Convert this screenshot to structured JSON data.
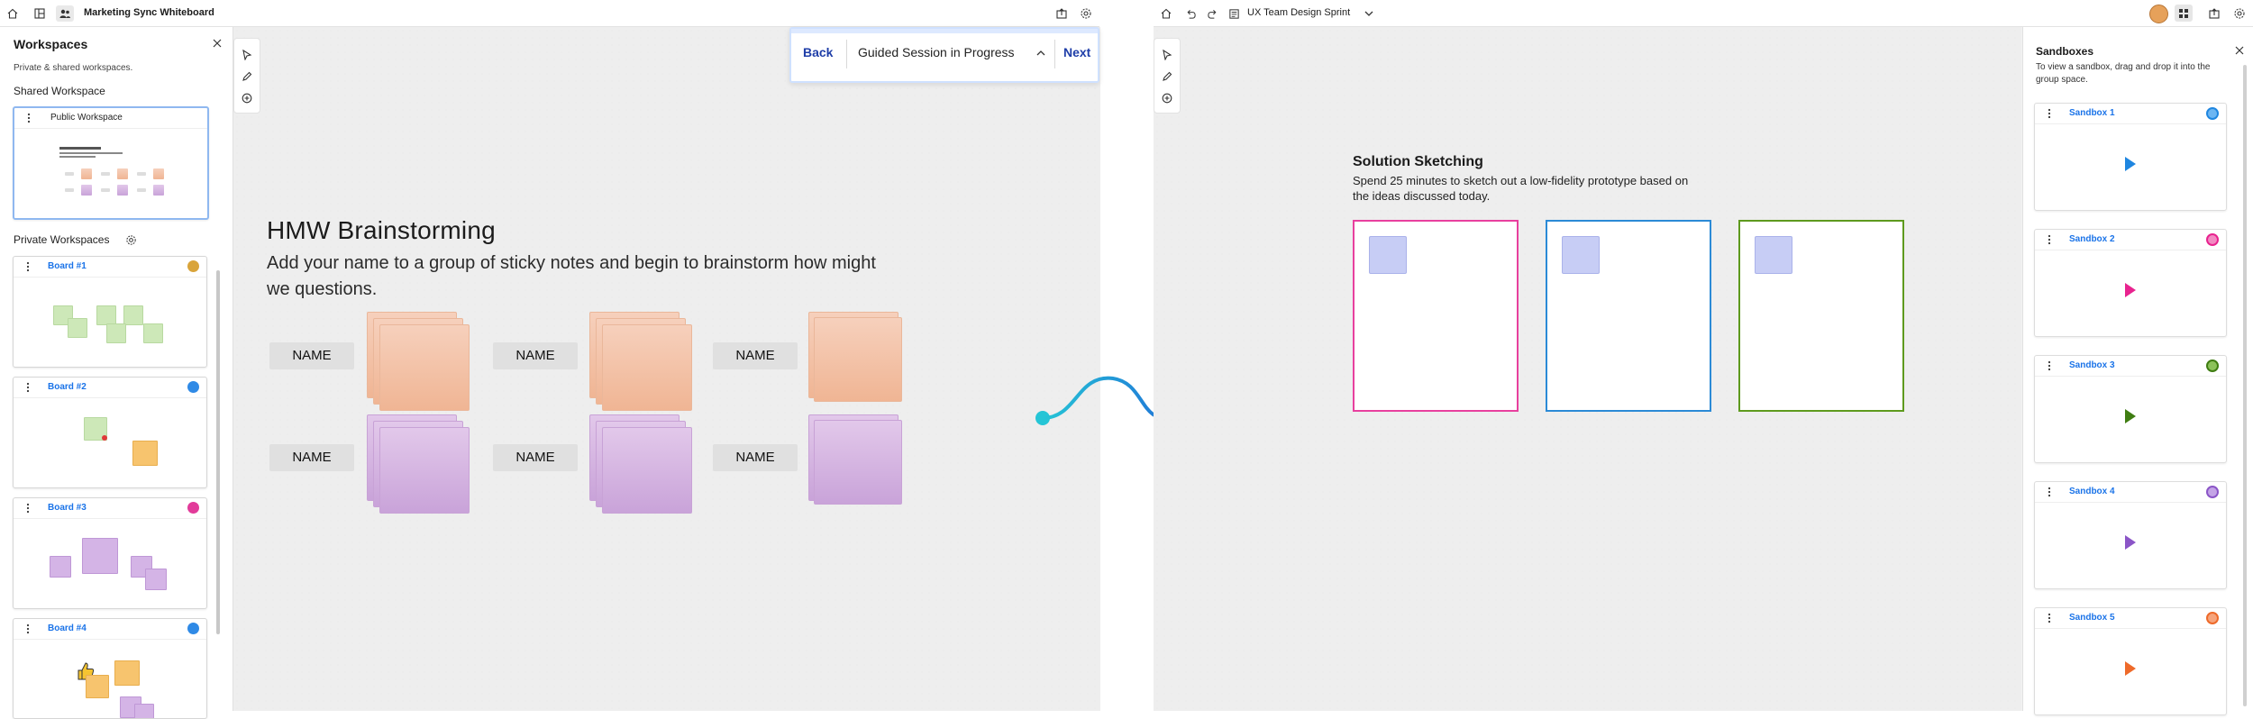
{
  "left": {
    "app_title": "Marketing Sync Whiteboard",
    "workspaces": {
      "title": "Workspaces",
      "subtitle": "Private & shared workspaces.",
      "shared_heading": "Shared Workspace",
      "public_label": "Public Workspace",
      "private_heading": "Private Workspaces",
      "boards": [
        {
          "label": "Board #1",
          "avatar_color": "#d9a43a"
        },
        {
          "label": "Board #2",
          "avatar_color": "#2f8ae6"
        },
        {
          "label": "Board #3",
          "avatar_color": "#e23b9a"
        },
        {
          "label": "Board #4",
          "avatar_color": "#2f8ae6"
        }
      ]
    },
    "guided": {
      "back": "Back",
      "status": "Guided Session in Progress",
      "next": "Next"
    },
    "hmw": {
      "title": "HMW Brainstorming",
      "body": "Add your name to a group of sticky notes and begin to brainstorm how might we questions.",
      "name_labels": [
        "NAME",
        "NAME",
        "NAME",
        "NAME",
        "NAME",
        "NAME"
      ]
    }
  },
  "right": {
    "app_title": "UX Team Design Sprint",
    "solution": {
      "title": "Solution Sketching",
      "body": "Spend 25 minutes to sketch out a low-fidelity prototype based on the ideas discussed today."
    },
    "frames": [
      {
        "color": "#e8409e"
      },
      {
        "color": "#2b8ad6"
      },
      {
        "color": "#5e9a1e"
      }
    ],
    "sandboxes": {
      "title": "Sandboxes",
      "subtitle": "To view a sandbox, drag and drop it into the group space.",
      "items": [
        {
          "label": "Sandbox 1",
          "color": "#1f86e0"
        },
        {
          "label": "Sandbox 2",
          "color": "#e8238f"
        },
        {
          "label": "Sandbox 3",
          "color": "#3f7d12"
        },
        {
          "label": "Sandbox 4",
          "color": "#8b55c7"
        },
        {
          "label": "Sandbox 5",
          "color": "#ee6a2a"
        }
      ]
    }
  },
  "colors": {
    "accent": "#1a73e8",
    "connector_start": "#25c5d6",
    "connector_end": "#1e4fd8"
  }
}
